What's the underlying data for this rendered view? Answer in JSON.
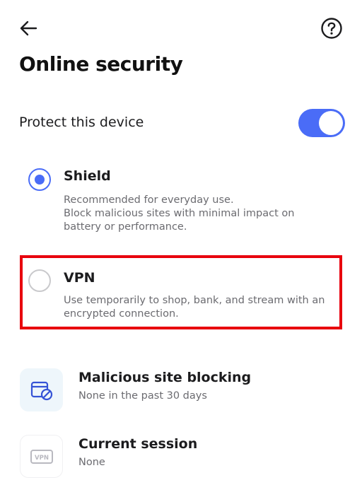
{
  "header": {
    "back_icon": "arrow-left-icon",
    "help_icon": "question-circle-icon"
  },
  "title": "Online security",
  "protect": {
    "label": "Protect this device",
    "toggle_on": true,
    "toggle_color": "#4a6cf7"
  },
  "options": [
    {
      "title": "Shield",
      "description": "Recommended for everyday use.\nBlock malicious sites with minimal impact on\nbattery or performance.",
      "selected": true
    },
    {
      "title": "VPN",
      "description": "Use temporarily to shop, bank, and stream with an\nencrypted connection.",
      "selected": false
    }
  ],
  "highlight_color": "#e8000d",
  "features": [
    {
      "title": "Malicious site blocking",
      "subtitle": "None in the past 30 days",
      "icon": "blocked-browser-icon"
    },
    {
      "title": "Current session",
      "subtitle": "None",
      "icon": "vpn-badge-icon",
      "icon_text": "VPN"
    }
  ]
}
